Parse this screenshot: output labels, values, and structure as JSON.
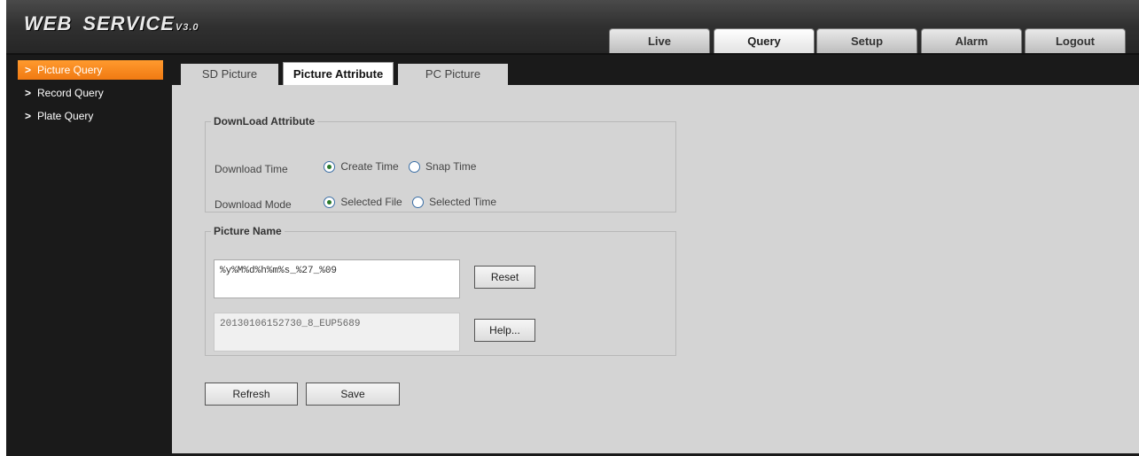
{
  "header": {
    "logo_main": "WEB",
    "logo_second": "SERVICE",
    "logo_version": "V3.0",
    "tabs": [
      {
        "label": "Live",
        "active": false
      },
      {
        "label": "Query",
        "active": true
      },
      {
        "label": "Setup",
        "active": false
      },
      {
        "label": "Alarm",
        "active": false
      },
      {
        "label": "Logout",
        "active": false
      }
    ]
  },
  "sidebar": {
    "items": [
      {
        "label": "Picture Query",
        "active": true
      },
      {
        "label": "Record Query",
        "active": false
      },
      {
        "label": "Plate Query",
        "active": false
      }
    ]
  },
  "subtabs": [
    {
      "label": "SD Picture",
      "active": false
    },
    {
      "label": "Picture Attribute",
      "active": true
    },
    {
      "label": "PC Picture",
      "active": false
    }
  ],
  "download_attribute": {
    "legend": "DownLoad Attribute",
    "time": {
      "label": "Download Time",
      "options": [
        {
          "label": "Create Time",
          "selected": true
        },
        {
          "label": "Snap Time",
          "selected": false
        }
      ]
    },
    "mode": {
      "label": "Download Mode",
      "options": [
        {
          "label": "Selected File",
          "selected": true
        },
        {
          "label": "Selected Time",
          "selected": false
        }
      ]
    }
  },
  "picture_name": {
    "legend": "Picture Name",
    "format_value": "%y%M%d%h%m%s_%27_%09",
    "preview_value": "20130106152730_8_EUP5689",
    "reset_label": "Reset",
    "help_label": "Help..."
  },
  "actions": {
    "refresh_label": "Refresh",
    "save_label": "Save"
  },
  "colors": {
    "accent": "#f08a1e",
    "panel": "#d4d4d4",
    "dark": "#1a1a1a"
  }
}
